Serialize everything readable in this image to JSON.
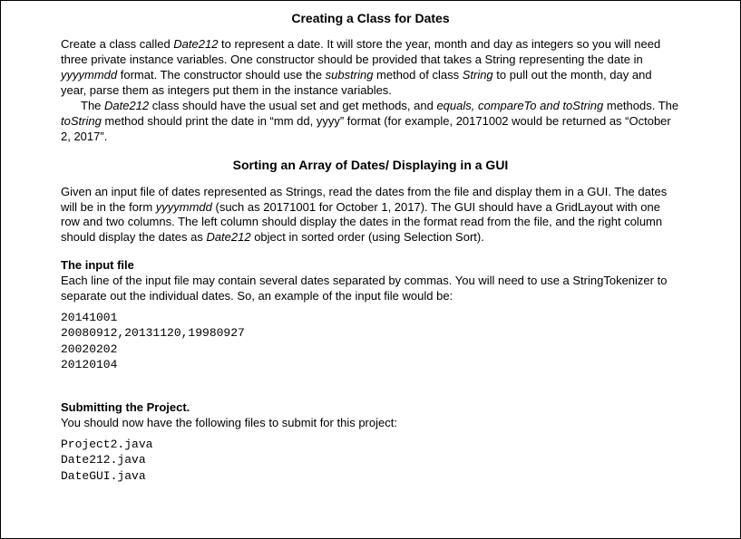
{
  "title1": "Creating a Class for Dates",
  "p1a": "Create a class called ",
  "p1_date212_1": "Date212",
  "p1b": " to represent a date. It will store the year, month and day as integers so you will need three private instance variables. One constructor should be provided that takes a String representing the date in ",
  "p1_yyyymmdd": "yyyymmdd",
  "p1c": " format. The constructor should use the ",
  "p1_substring": "substring",
  "p1d": " method of class ",
  "p1_string": "String",
  "p1e": " to pull out the month, day and year, parse them as integers put them in the instance variables.",
  "p2a": "The ",
  "p2_date212": "Date212",
  "p2b": " class should have the usual set and get methods, and ",
  "p2_equals": "equals, compareTo and toString",
  "p2c": " methods. The ",
  "p2_tostring": "toString",
  "p2d": " method should print the date in “mm dd, yyyy” format (for example, 20171002 would be returned as “October 2, 2017”.",
  "title2": "Sorting an Array of Dates/ Displaying in a GUI",
  "p3a": "Given an input file of dates represented as Strings, read the dates from the file and display them in a GUI. The dates will be in the form ",
  "p3_yyyymmdd": "yyyymmdd",
  "p3b": " (such as 20171001 for October 1, 2017). The GUI should have a GridLayout with one row and two columns. The left column should display the dates in the format read from the file, and the right column should display the dates as ",
  "p3_date212": "Date212",
  "p3c": " object in sorted order (using Selection Sort).",
  "h_input": "The input file",
  "p4": "Each line of the input file may contain several dates separated by commas. You will need to use a StringTokenizer to separate out the individual dates. So, an example of the input file would be:",
  "code1": "20141001",
  "code2": "20080912,20131120,19980927",
  "code3": "20020202",
  "code4": "20120104",
  "h_submit": "Submitting the Project.",
  "p5": "You should now have the following files to submit for this project:",
  "file1": "Project2.java",
  "file2": "Date212.java",
  "file3": "DateGUI.java"
}
